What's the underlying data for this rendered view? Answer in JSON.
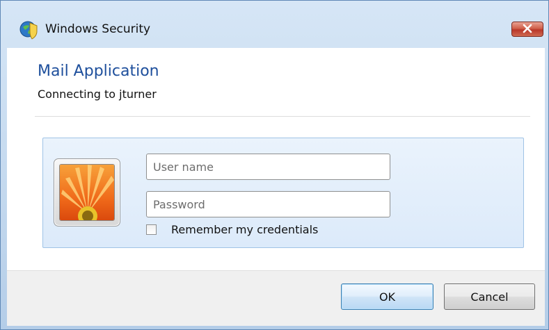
{
  "window": {
    "title": "Windows Security",
    "close_icon": "close-icon"
  },
  "header": {
    "app_title": "Mail Application",
    "connecting_text": "Connecting to jturner"
  },
  "credentials": {
    "avatar_icon": "user-avatar-flower-icon",
    "username": {
      "value": "",
      "placeholder": "User name"
    },
    "password": {
      "value": "",
      "placeholder": "Password"
    },
    "remember": {
      "label": "Remember my credentials",
      "checked": false
    }
  },
  "buttons": {
    "ok_label": "OK",
    "cancel_label": "Cancel"
  },
  "colors": {
    "accent_title": "#1e4f9c",
    "close_button": "#c7412f",
    "panel_background": "#dceafa"
  }
}
